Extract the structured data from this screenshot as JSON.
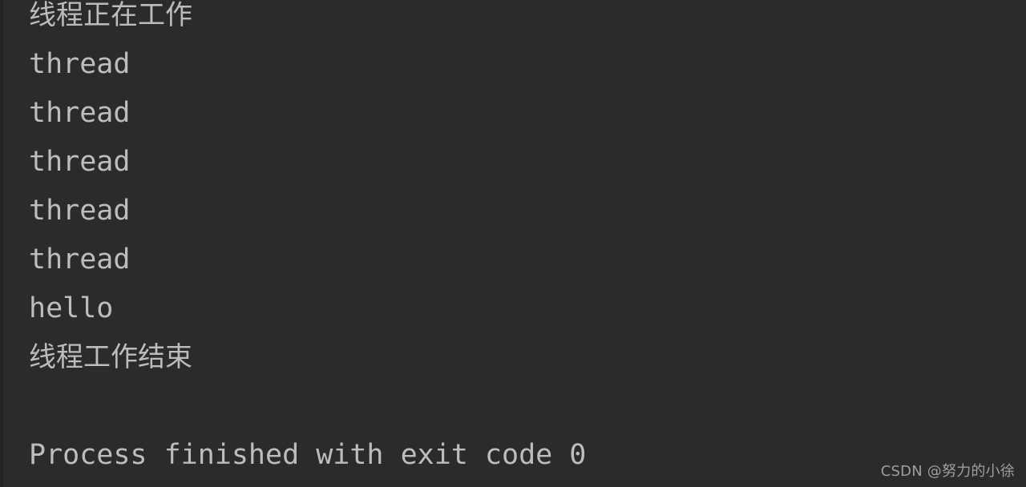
{
  "theme": {
    "background": "#2b2b2b",
    "gutter": "#242424",
    "text_color": "#bdbdbd",
    "watermark_color": "#9e9e9e"
  },
  "console": {
    "lines": [
      {
        "text": "线程正在工作",
        "kind": "cjk"
      },
      {
        "text": "thread",
        "kind": "ascii"
      },
      {
        "text": "thread",
        "kind": "ascii"
      },
      {
        "text": "thread",
        "kind": "ascii"
      },
      {
        "text": "thread",
        "kind": "ascii"
      },
      {
        "text": "thread",
        "kind": "ascii"
      },
      {
        "text": "hello",
        "kind": "ascii"
      },
      {
        "text": "线程工作结束",
        "kind": "cjk"
      },
      {
        "text": " ",
        "kind": "blank"
      },
      {
        "text": "Process finished with exit code 0",
        "kind": "exit"
      }
    ],
    "line_0": "线程正在工作",
    "line_1": "thread",
    "line_2": "thread",
    "line_3": "thread",
    "line_4": "thread",
    "line_5": "thread",
    "line_6": "hello",
    "line_7": "线程工作结束",
    "line_8": " ",
    "line_9": "Process finished with exit code 0"
  },
  "watermark": {
    "text": "CSDN @努力的小徐"
  }
}
